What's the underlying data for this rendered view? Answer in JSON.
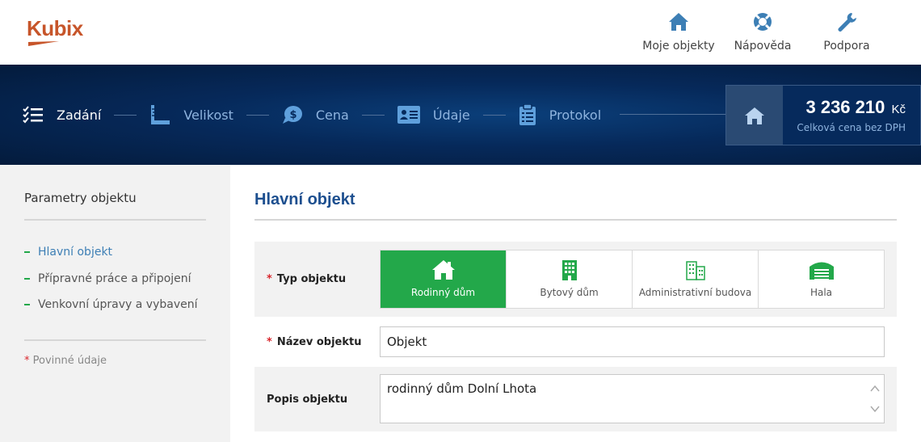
{
  "header": {
    "logo_text": "Kubix",
    "links": [
      {
        "label": "Moje objekty",
        "icon": "home-icon"
      },
      {
        "label": "Nápověda",
        "icon": "lifebuoy-icon"
      },
      {
        "label": "Podpora",
        "icon": "wrench-icon"
      }
    ]
  },
  "steps": [
    {
      "label": "Zadání",
      "icon": "checklist-icon",
      "active": true
    },
    {
      "label": "Velikost",
      "icon": "ruler-icon",
      "active": false
    },
    {
      "label": "Cena",
      "icon": "money-bubble-icon",
      "active": false
    },
    {
      "label": "Údaje",
      "icon": "id-card-icon",
      "active": false
    },
    {
      "label": "Protokol",
      "icon": "clipboard-icon",
      "active": false
    }
  ],
  "price": {
    "amount": "3 236 210",
    "currency": "Kč",
    "note": "Celková cena bez DPH"
  },
  "sidebar": {
    "title": "Parametry objektu",
    "items": [
      {
        "label": "Hlavní objekt",
        "active": true
      },
      {
        "label": "Přípravné práce a připojení",
        "active": false
      },
      {
        "label": "Venkovní úpravy a vybavení",
        "active": false
      }
    ],
    "required_star": "*",
    "required_note": "Povinné údaje"
  },
  "main": {
    "title": "Hlavní objekt",
    "type_label": "Typ objektu",
    "types": [
      {
        "label": "Rodinný dům",
        "selected": true
      },
      {
        "label": "Bytový dům",
        "selected": false
      },
      {
        "label": "Administrativní budova",
        "selected": false
      },
      {
        "label": "Hala",
        "selected": false
      }
    ],
    "name_label": "Název objektu",
    "name_value": "Objekt",
    "desc_label": "Popis objektu",
    "desc_value": "rodinný dům Dolní Lhota"
  },
  "colors": {
    "brand": "#c7552a",
    "accent_green": "#23a84a",
    "banner_dark": "#041b3c",
    "title_blue": "#1d4f8f",
    "required_red": "#d9262c"
  }
}
